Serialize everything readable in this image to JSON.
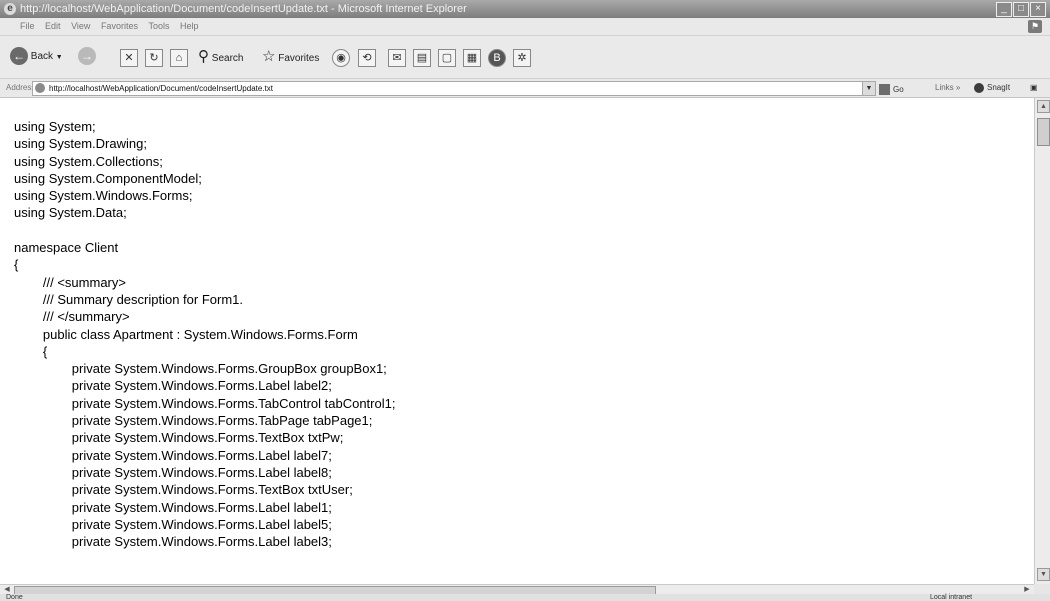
{
  "window": {
    "title": "http://localhost/WebApplication/Document/codeInsertUpdate.txt - Microsoft Internet Explorer",
    "controls": {
      "minimize": "_",
      "maximize": "□",
      "close": "×"
    }
  },
  "menu": [
    "File",
    "Edit",
    "View",
    "Favorites",
    "Tools",
    "Help"
  ],
  "toolbar": {
    "back": "Back",
    "search": "Search",
    "favorites": "Favorites"
  },
  "address": {
    "label": "Address",
    "url": "http://localhost/WebApplication/Document/codeInsertUpdate.txt",
    "go": "Go",
    "links": "Links",
    "more": "»",
    "snagit": "SnagIt"
  },
  "document": {
    "lines": [
      "using System;",
      "using System.Drawing;",
      "using System.Collections;",
      "using System.ComponentModel;",
      "using System.Windows.Forms;",
      "using System.Data;",
      "",
      "namespace Client",
      "{",
      "        /// <summary>",
      "        /// Summary description for Form1.",
      "        /// </summary>",
      "        public class Apartment : System.Windows.Forms.Form",
      "        {",
      "                private System.Windows.Forms.GroupBox groupBox1;",
      "                private System.Windows.Forms.Label label2;",
      "                private System.Windows.Forms.TabControl tabControl1;",
      "                private System.Windows.Forms.TabPage tabPage1;",
      "                private System.Windows.Forms.TextBox txtPw;",
      "                private System.Windows.Forms.Label label7;",
      "                private System.Windows.Forms.Label label8;",
      "                private System.Windows.Forms.TextBox txtUser;",
      "                private System.Windows.Forms.Label label1;",
      "                private System.Windows.Forms.Label label5;",
      "                private System.Windows.Forms.Label label3;"
    ]
  },
  "status": {
    "text": "Done",
    "zone": "Local intranet"
  },
  "colors": {
    "titlebar": "#8a8a8a",
    "page": "#ffffff"
  }
}
